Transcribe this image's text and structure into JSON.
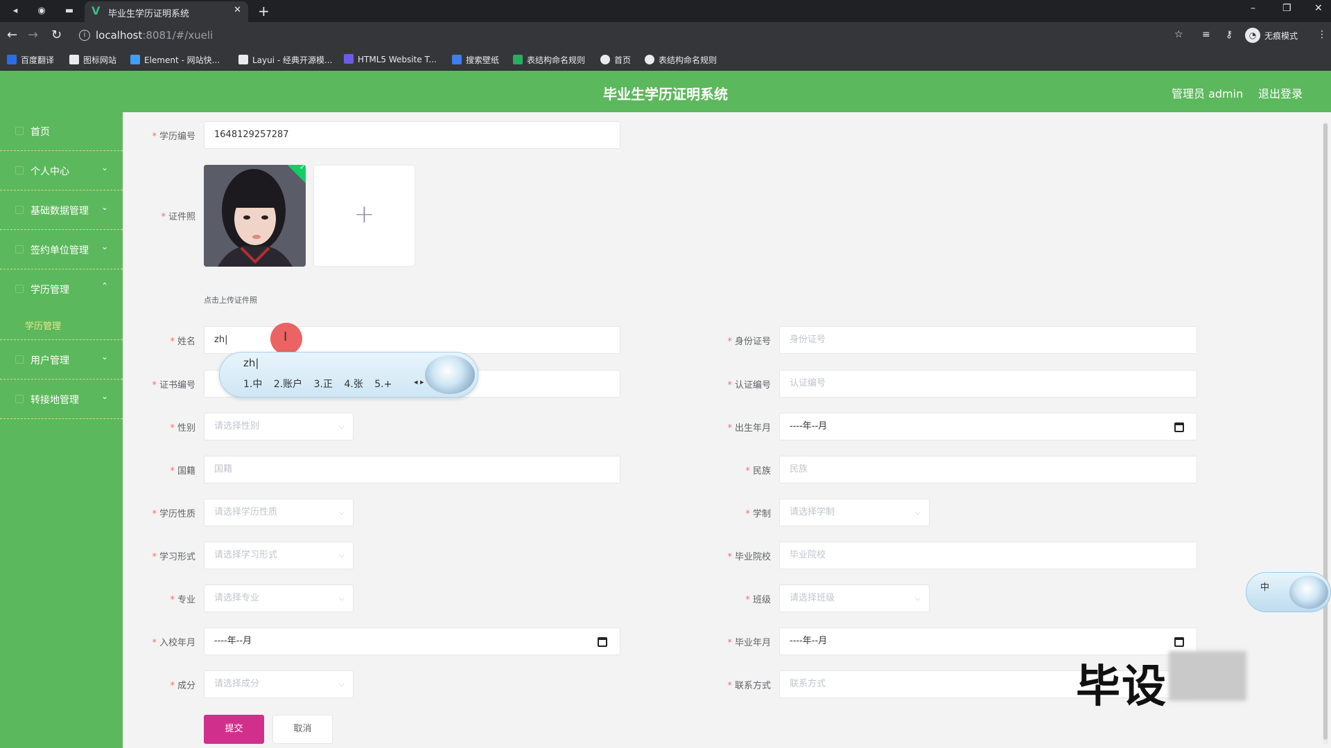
{
  "browser": {
    "tab_title": "毕业生学历证明系统",
    "tab_close": "✕",
    "new_tab": "+",
    "url_host": "localhost",
    "url_rest": ":8081/#/xueli",
    "incognito_label": "无痕模式",
    "bookmarks": [
      {
        "label": "百度翻译",
        "icon_color": "#2b6de8"
      },
      {
        "label": "图标网站",
        "icon_color": "#e8eaed"
      },
      {
        "label": "Element - 网站快...",
        "icon_color": "#409eff"
      },
      {
        "label": "Layui - 经典开源模...",
        "icon_color": "#e8eaed"
      },
      {
        "label": "HTML5 Website T...",
        "icon_color": "#6c5ce7"
      },
      {
        "label": "搜索壁纸",
        "icon_color": "#3d7ef0"
      },
      {
        "label": "表结构命名规则",
        "icon_color": "#27ae60"
      },
      {
        "label": "首页",
        "icon_color": "#e8eaed"
      },
      {
        "label": "表结构命名规则",
        "icon_color": "#e8eaed"
      }
    ]
  },
  "app": {
    "title": "毕业生学历证明系统",
    "user_label": "管理员 admin",
    "logout_label": "退出登录",
    "accent_color": "#5cb85c",
    "submit_color": "#d0308c"
  },
  "sidebar": {
    "items": [
      {
        "label": "首页",
        "arrow": ""
      },
      {
        "label": "个人中心",
        "arrow": "⌄"
      },
      {
        "label": "基础数据管理",
        "arrow": "⌄"
      },
      {
        "label": "签约单位管理",
        "arrow": "⌄"
      },
      {
        "label": "学历管理",
        "arrow": "⌃"
      },
      {
        "label": "用户管理",
        "arrow": "⌄"
      },
      {
        "label": "转接地管理",
        "arrow": "⌄"
      }
    ],
    "sub_active": "学历管理"
  },
  "form": {
    "xueli_no": {
      "label": "学历编号",
      "value": "1648129257287"
    },
    "photo": {
      "label": "证件照",
      "tip": "点击上传证件照"
    },
    "name": {
      "label": "姓名",
      "value": "zh"
    },
    "id_card": {
      "label": "身份证号",
      "placeholder": "身份证号"
    },
    "cert_no": {
      "label": "证书编号"
    },
    "auth_no": {
      "label": "认证编号",
      "placeholder": "认证编号"
    },
    "gender": {
      "label": "性别",
      "placeholder": "请选择性别"
    },
    "birth": {
      "label": "出生年月",
      "placeholder": "----年--月"
    },
    "nationality": {
      "label": "国籍",
      "placeholder": "国籍"
    },
    "ethnic": {
      "label": "民族",
      "placeholder": "民族"
    },
    "edu_type": {
      "label": "学历性质",
      "placeholder": "请选择学历性质"
    },
    "edu_system": {
      "label": "学制",
      "placeholder": "请选择学制"
    },
    "study_form": {
      "label": "学习形式",
      "placeholder": "请选择学习形式"
    },
    "school": {
      "label": "毕业院校",
      "placeholder": "毕业院校"
    },
    "major": {
      "label": "专业",
      "placeholder": "请选择专业"
    },
    "class": {
      "label": "班级",
      "placeholder": "请选择班级"
    },
    "enroll": {
      "label": "入校年月",
      "placeholder": "----年--月"
    },
    "graduate": {
      "label": "毕业年月",
      "placeholder": "----年--月"
    },
    "origin": {
      "label": "成分",
      "placeholder": "请选择成分"
    },
    "contact": {
      "label": "联系方式",
      "placeholder": "联系方式"
    },
    "submit_label": "提交",
    "cancel_label": "取消"
  },
  "ime": {
    "input": "zh",
    "candidates": [
      "1.中",
      "2.账户",
      "3.正",
      "4.张",
      "5.+"
    ],
    "float_label": "中"
  },
  "watermark": "毕设"
}
